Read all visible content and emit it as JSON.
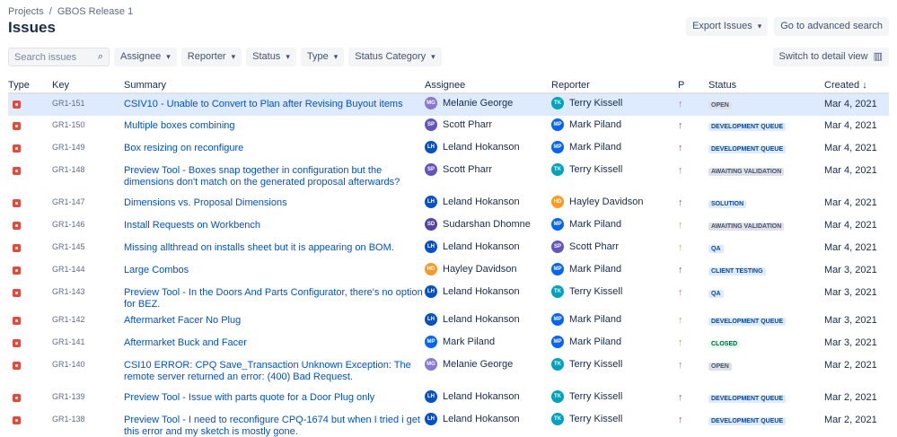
{
  "breadcrumb": {
    "projects": "Projects",
    "sep": "/",
    "release": "GBOS Release 1"
  },
  "title": "Issues",
  "actions": {
    "export": "Export Issues",
    "advanced": "Go to advanced search",
    "detail": "Switch to detail view"
  },
  "search": {
    "placeholder": "Search issues"
  },
  "filters": {
    "assignee": "Assignee",
    "reporter": "Reporter",
    "status": "Status",
    "type": "Type",
    "status_category": "Status Category"
  },
  "columns": {
    "type": "Type",
    "key": "Key",
    "summary": "Summary",
    "assignee": "Assignee",
    "reporter": "Reporter",
    "priority": "P",
    "status": "Status",
    "created": "Created ↓"
  },
  "colors": {
    "highest": "#d04437",
    "high": "#f15c75",
    "medium": "#f79232"
  },
  "people": {
    "MG": {
      "name": "Melanie George",
      "color": "#8777d9"
    },
    "SP": {
      "name": "Scott Pharr",
      "color": "#6554c0"
    },
    "LH": {
      "name": "Leland Hokanson",
      "color": "#0052cc"
    },
    "SD": {
      "name": "Sudarshan Dhomne",
      "color": "#5243aa"
    },
    "HD": {
      "name": "Hayley Davidson",
      "color": "#ff991f"
    },
    "MP": {
      "name": "Mark Piland",
      "color": "#0065ff"
    },
    "TK": {
      "name": "Terry Kissell",
      "color": "#00a3bf"
    }
  },
  "issues": [
    {
      "key": "GR1-151",
      "summary": "CSIV10 - Unable to Convert to Plan after Revising Buyout items",
      "assignee": "MG",
      "reporter": "TK",
      "priority": "high",
      "status": "OPEN",
      "status_style": "grey",
      "created": "Mar 4, 2021",
      "selected": true
    },
    {
      "key": "GR1-150",
      "summary": "Multiple boxes combining",
      "assignee": "SP",
      "reporter": "MP",
      "priority": "highest",
      "status": "DEVELOPMENT QUEUE",
      "status_style": "blue",
      "created": "Mar 4, 2021"
    },
    {
      "key": "GR1-149",
      "summary": "Box resizing on reconfigure",
      "assignee": "LH",
      "reporter": "MP",
      "priority": "highest",
      "status": "DEVELOPMENT QUEUE",
      "status_style": "blue",
      "created": "Mar 4, 2021"
    },
    {
      "key": "GR1-148",
      "summary": "Preview Tool - Boxes snap together in configuration but the dimensions don't match on the generated proposal afterwards?",
      "assignee": "SP",
      "reporter": "TK",
      "priority": "high",
      "status": "AWAITING VALIDATION",
      "status_style": "grey",
      "created": "Mar 4, 2021"
    },
    {
      "key": "GR1-147",
      "summary": "Dimensions vs. Proposal Dimensions",
      "assignee": "LH",
      "reporter": "HD",
      "priority": "highest",
      "status": "SOLUTION",
      "status_style": "blue",
      "created": "Mar 4, 2021"
    },
    {
      "key": "GR1-146",
      "summary": "Install Requests on Workbench",
      "assignee": "SD",
      "reporter": "MP",
      "priority": "medium",
      "status": "AWAITING VALIDATION",
      "status_style": "grey",
      "created": "Mar 4, 2021"
    },
    {
      "key": "GR1-145",
      "summary": "Missing allthread on installs sheet but it is appearing on BOM.",
      "assignee": "LH",
      "reporter": "SP",
      "priority": "medium",
      "status": "QA",
      "status_style": "blue",
      "created": "Mar 4, 2021"
    },
    {
      "key": "GR1-144",
      "summary": "Large Combos",
      "assignee": "HD",
      "reporter": "MP",
      "priority": "highest",
      "status": "CLIENT TESTING",
      "status_style": "blue",
      "created": "Mar 3, 2021"
    },
    {
      "key": "GR1-143",
      "summary": "Preview Tool - In the Doors And Parts Configurator, there's no option for BEZ.",
      "assignee": "LH",
      "reporter": "TK",
      "priority": "high",
      "status": "QA",
      "status_style": "blue",
      "created": "Mar 3, 2021"
    },
    {
      "key": "GR1-142",
      "summary": "Aftermarket Facer No Plug",
      "assignee": "LH",
      "reporter": "MP",
      "priority": "medium",
      "status": "DEVELOPMENT QUEUE",
      "status_style": "blue",
      "created": "Mar 3, 2021"
    },
    {
      "key": "GR1-141",
      "summary": "Aftermarket Buck and Facer",
      "assignee": "MP",
      "reporter": "MP",
      "priority": "medium",
      "status": "CLOSED",
      "status_style": "green",
      "created": "Mar 3, 2021"
    },
    {
      "key": "GR1-140",
      "summary": "CSI10 ERROR: CPQ Save_Transaction Unknown Exception: The remote server returned an error: (400) Bad Request.",
      "assignee": "MG",
      "reporter": "TK",
      "priority": "high",
      "status": "OPEN",
      "status_style": "grey",
      "created": "Mar 2, 2021"
    },
    {
      "key": "GR1-139",
      "summary": "Preview Tool - Issue with parts quote for a Door Plug only",
      "assignee": "LH",
      "reporter": "TK",
      "priority": "highest",
      "status": "DEVELOPMENT QUEUE",
      "status_style": "blue",
      "created": "Mar 2, 2021"
    },
    {
      "key": "GR1-138",
      "summary": "Preview Tool - I need to reconfigure CPQ-1674 but when I tried i get this error and my sketch is mostly gone.",
      "assignee": "LH",
      "reporter": "TK",
      "priority": "highest",
      "status": "DEVELOPMENT QUEUE",
      "status_style": "blue",
      "created": "Mar 2, 2021"
    }
  ]
}
